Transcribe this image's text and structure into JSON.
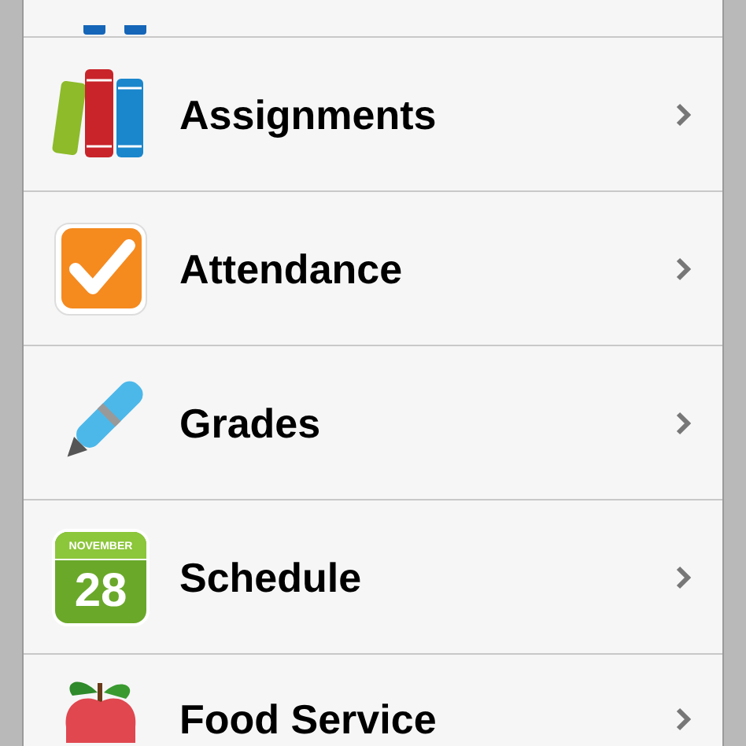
{
  "menu_items": [
    {
      "kind": "books",
      "label": "Assignments"
    },
    {
      "kind": "checkmark",
      "label": "Attendance"
    },
    {
      "kind": "marker",
      "label": "Grades"
    },
    {
      "kind": "calendar",
      "label": "Schedule",
      "icon_month": "NOVEMBER",
      "icon_day": "28"
    },
    {
      "kind": "apple",
      "label": "Food Service"
    }
  ]
}
